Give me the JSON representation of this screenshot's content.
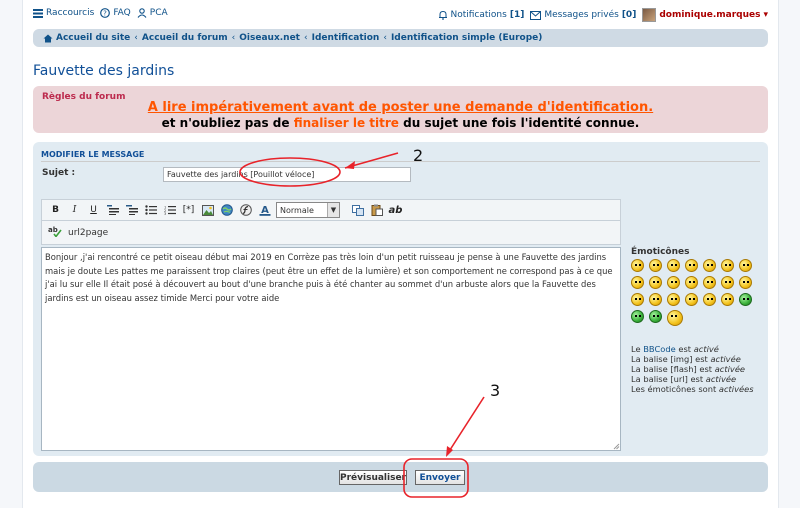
{
  "topbar": {
    "shortcuts": "Raccourcis",
    "faq": "FAQ",
    "pca": "PCA",
    "notifications_label": "Notifications",
    "notifications_count": "[1]",
    "pm_label": "Messages privés",
    "pm_count": "[0]",
    "username": "dominique.marques",
    "username_caret": "▾"
  },
  "breadcrumb": [
    "Accueil du site",
    "Accueil du forum",
    "Oiseaux.net",
    "Identification",
    "Identification simple (Europe)"
  ],
  "page_title": "Fauvette des jardins",
  "rules": {
    "title": "Règles du forum",
    "line1": "A lire impérativement avant de poster une demande d'identification.",
    "line2_before": "et n'oubliez pas de",
    "line2_highlight": "finaliser le titre",
    "line2_after": "du sujet une fois l'identité connue."
  },
  "form": {
    "header": "MODIFIER LE MESSAGE",
    "subject_label": "Sujet :",
    "subject_value": "Fauvette des jardins [Pouillot véloce]",
    "font_size_selected": "Normale",
    "url2page": "url2page",
    "message_body": "Bonjour ,j'ai  rencontré ce petit oiseau  début mai 2019 en Corrèze pas très loin d'un petit ruisseau je pense à une Fauvette des jardins  mais je doute Les pattes me paraissent trop claires (peut être un effet de la lumière) et son comportement ne correspond pas à ce que j'ai lu sur elle Il était posé à découvert au bout d'une branche puis à été chanter au sommet d'un arbuste  alors que la Fauvette des jardins est un oiseau assez timide  Merci pour votre aide"
  },
  "toolbar_icons": [
    "bold-icon",
    "italic-icon",
    "underline-icon",
    "quote-icon",
    "code-icon",
    "bullet-list-icon",
    "numbered-list-icon",
    "list-item-icon",
    "image-icon",
    "url-icon",
    "flash-icon",
    "font-color-icon",
    "copy-icon",
    "paste-icon",
    "abbr-icon"
  ],
  "smilies": {
    "title": "Émoticônes",
    "count": 24
  },
  "status": {
    "line1_pre": "Le",
    "line1_link": "BBCode",
    "line1_mid": "est",
    "line1_state": "activé",
    "line2_pre": "La balise [img] est",
    "line2_state": "activée",
    "line3_pre": "La balise [flash] est",
    "line3_state": "activée",
    "line4_pre": "La balise [url] est",
    "line4_state": "activée",
    "line5_pre": "Les émoticônes sont",
    "line5_state": "activées"
  },
  "buttons": {
    "preview": "Prévisualiser",
    "send": "Envoyer"
  },
  "annotations": {
    "label2": "2",
    "label3": "3",
    "color": "#e8232a"
  }
}
